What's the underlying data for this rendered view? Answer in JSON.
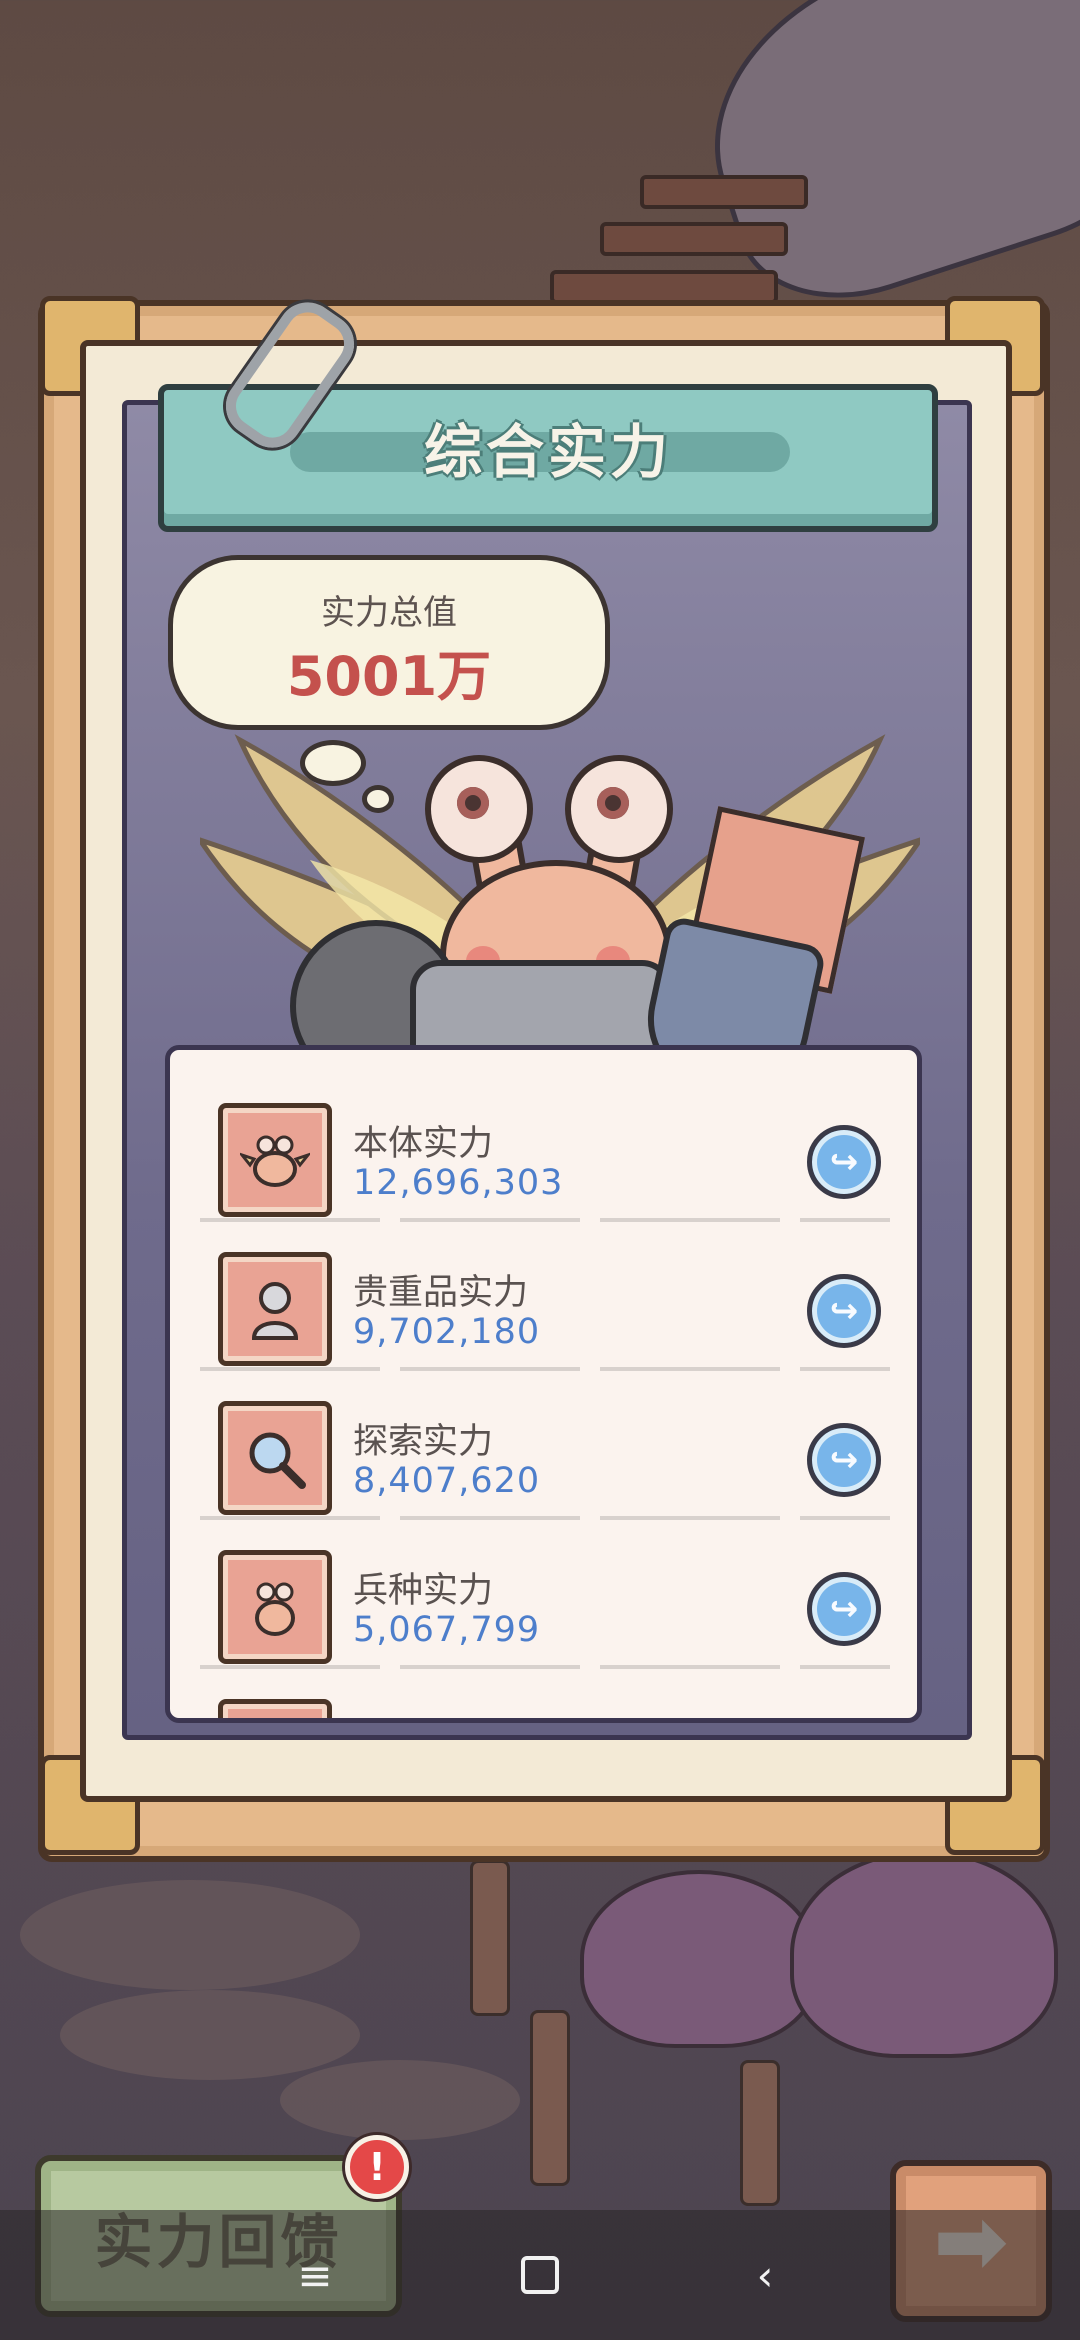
{
  "panel": {
    "title": "综合实力"
  },
  "total": {
    "label": "实力总值",
    "value": "5001万"
  },
  "stats": [
    {
      "label": "本体实力",
      "value": "12,696,303",
      "icon": "winged-snail-icon"
    },
    {
      "label": "贵重品实力",
      "value": "9,702,180",
      "icon": "bust-statue-icon"
    },
    {
      "label": "探索实力",
      "value": "8,407,620",
      "icon": "magnifier-icon"
    },
    {
      "label": "兵种实力",
      "value": "5,067,799",
      "icon": "troop-snail-icon"
    }
  ],
  "buttons": {
    "feedback_label": "实力回馈",
    "alert_mark": "!",
    "next_icon": "arrow-right-icon"
  },
  "navbar": {
    "menu_icon": "menu-icon",
    "home_icon": "home-square-icon",
    "back_icon": "back-chevron-icon"
  },
  "colors": {
    "value_blue": "#4d7ecb",
    "total_red": "#c4514d",
    "title_teal": "#8fc9c2",
    "share_blue": "#78b5ea"
  }
}
